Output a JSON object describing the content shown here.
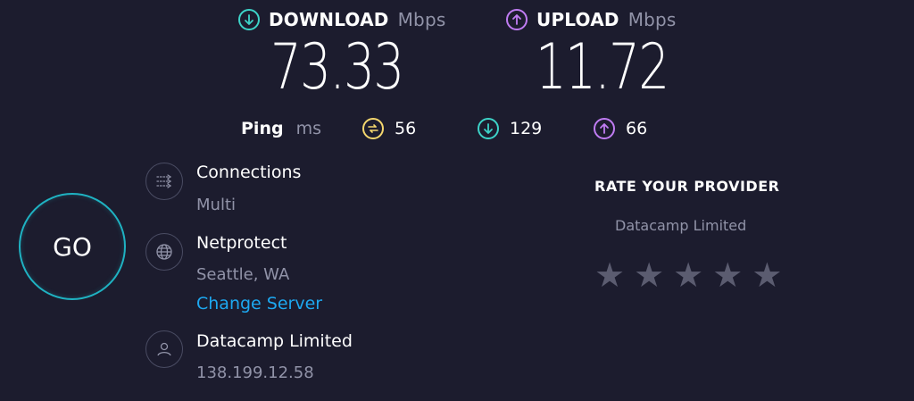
{
  "download": {
    "label": "DOWNLOAD",
    "unit": "Mbps",
    "value": "73.33",
    "icon": "arrow-down-circle-icon",
    "color": "#3dd3c8"
  },
  "upload": {
    "label": "UPLOAD",
    "unit": "Mbps",
    "value": "11.72",
    "icon": "arrow-up-circle-icon",
    "color": "#c07cf3"
  },
  "ping": {
    "label": "Ping",
    "unit": "ms",
    "idle": "56",
    "download": "129",
    "upload": "66",
    "idle_color": "#f5d76e"
  },
  "go_button": {
    "label": "GO",
    "ring_color": "#1fb2c2"
  },
  "connections": {
    "title": "Connections",
    "value": "Multi",
    "icon": "connections-icon"
  },
  "server": {
    "title": "Netprotect",
    "location": "Seattle, WA",
    "change_label": "Change Server",
    "icon": "globe-icon",
    "link_color": "#1da8f0"
  },
  "provider": {
    "title": "Datacamp Limited",
    "ip": "138.199.12.58",
    "icon": "user-icon"
  },
  "rate": {
    "title": "RATE YOUR PROVIDER",
    "provider": "Datacamp Limited",
    "rating": 0,
    "max_rating": 5,
    "star_color": "#5b5c70"
  }
}
